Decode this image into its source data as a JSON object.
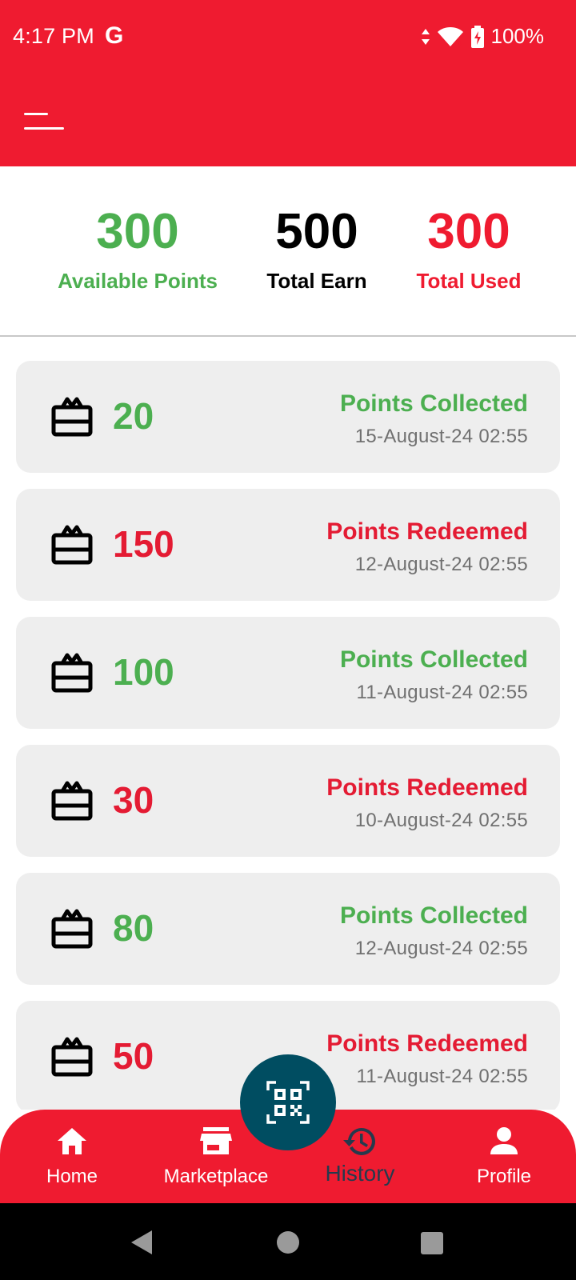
{
  "status_bar": {
    "time": "4:17 PM",
    "g_label": "G",
    "battery": "100%"
  },
  "header": {
    "menu_icon": "menu-icon"
  },
  "summary": {
    "available": {
      "value": "300",
      "label": "Available Points"
    },
    "earned": {
      "value": "500",
      "label": "Total Earn"
    },
    "used": {
      "value": "300",
      "label": "Total Used"
    }
  },
  "transactions": [
    {
      "points": "20",
      "type": "Points Collected",
      "date": "15-August-24 02:55",
      "kind": "collected"
    },
    {
      "points": "150",
      "type": "Points Redeemed",
      "date": "12-August-24 02:55",
      "kind": "redeemed"
    },
    {
      "points": "100",
      "type": "Points Collected",
      "date": "11-August-24 02:55",
      "kind": "collected"
    },
    {
      "points": "30",
      "type": "Points Redeemed",
      "date": "10-August-24 02:55",
      "kind": "redeemed"
    },
    {
      "points": "80",
      "type": "Points Collected",
      "date": "12-August-24 02:55",
      "kind": "collected"
    },
    {
      "points": "50",
      "type": "Points Redeemed",
      "date": "11-August-24 02:55",
      "kind": "redeemed"
    }
  ],
  "bottom_nav": {
    "home": "Home",
    "marketplace": "Marketplace",
    "history": "History",
    "profile": "Profile",
    "active": "history"
  },
  "colors": {
    "primary_red": "#ef1b30",
    "collected_green": "#4caf50",
    "redeemed_red": "#e41b33",
    "fab": "#004d61",
    "active_nav_text": "#263a4d"
  }
}
